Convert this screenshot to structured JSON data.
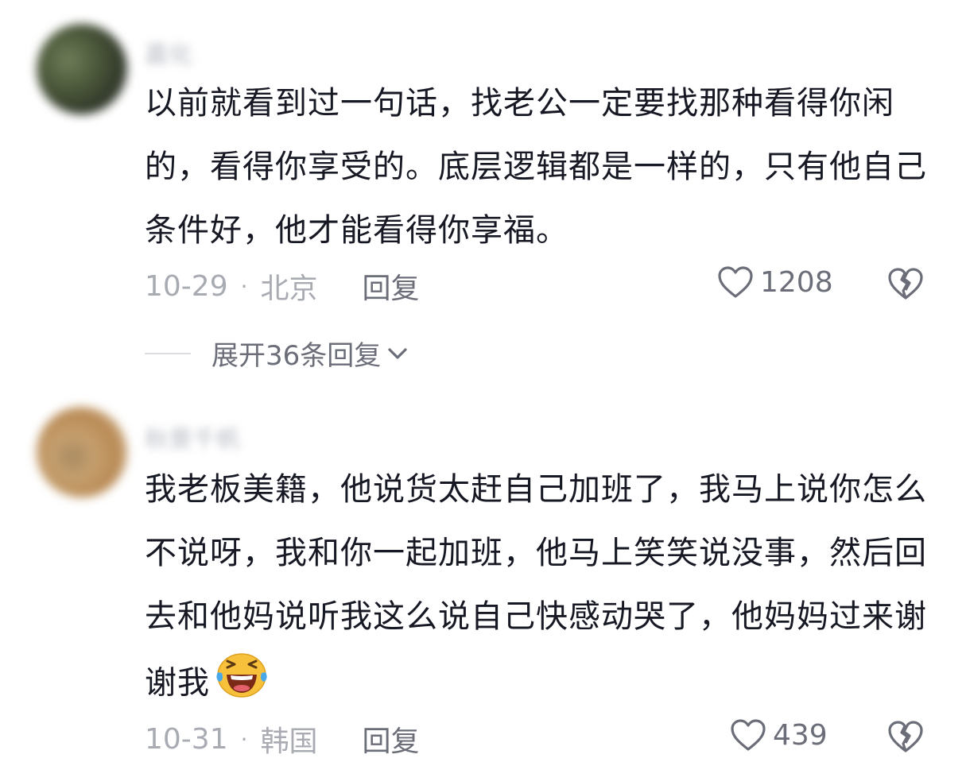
{
  "comments": [
    {
      "username": "嘉化",
      "text": "以前就看到过一句话，找老公一定要找那种看得你闲的，看得你享受的。底层逻辑都是一样的，只有他自己条件好，他才能看得你享福。",
      "date": "10-29",
      "dot": "·",
      "location": "北京",
      "reply_label": "回复",
      "likes": "1208",
      "expand_label": "展开36条回复"
    },
    {
      "username": "秋景千帆",
      "text": "我老板美籍，他说货太赶自己加班了，我马上说你怎么不说呀，我和你一起加班，他马上笑笑说没事，然后回去和他妈说听我这么说自己快感动哭了，他妈妈过来谢谢我",
      "emoji": "laughing-crying-emoji",
      "date": "10-31",
      "dot": "·",
      "location": "韩国",
      "reply_label": "回复",
      "likes": "439"
    }
  ],
  "colors": {
    "text": "#161823",
    "meta": "#a9abb3",
    "action": "#6b6e78",
    "emoji_face": "#f7c13b"
  }
}
